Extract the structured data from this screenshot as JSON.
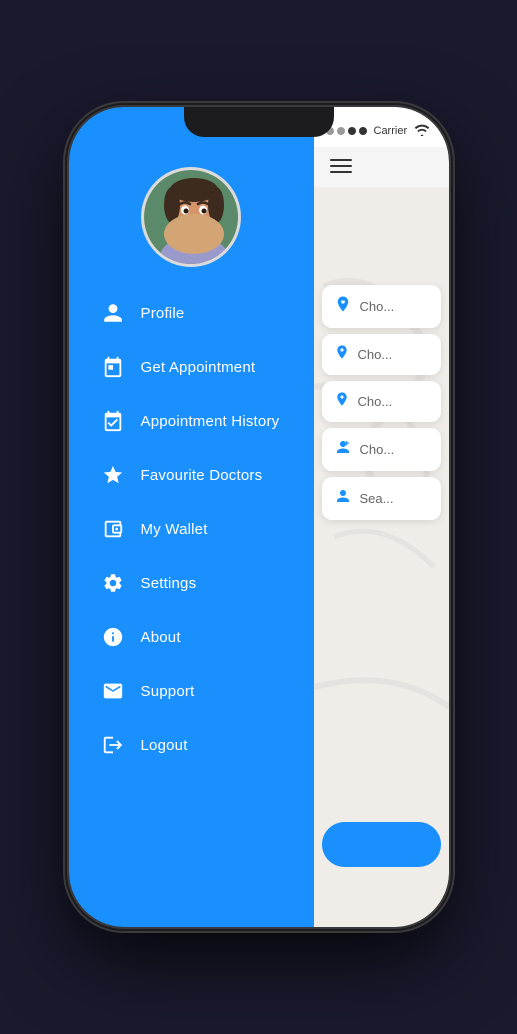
{
  "phone": {
    "status_bar": {
      "signal_dots": 4,
      "signal_filled": 2,
      "carrier": "Carrier",
      "wifi": "wifi"
    }
  },
  "sidebar": {
    "menu_items": [
      {
        "id": "profile",
        "label": "Profile",
        "icon": "person"
      },
      {
        "id": "get-appointment",
        "label": "Get Appointment",
        "icon": "calendar"
      },
      {
        "id": "appointment-history",
        "label": "Appointment History",
        "icon": "calendar-check"
      },
      {
        "id": "favourite-doctors",
        "label": "Favourite Doctors",
        "icon": "star"
      },
      {
        "id": "my-wallet",
        "label": "My Wallet",
        "icon": "wallet"
      },
      {
        "id": "settings",
        "label": "Settings",
        "icon": "gear"
      },
      {
        "id": "about",
        "label": "About",
        "icon": "info"
      },
      {
        "id": "support",
        "label": "Support",
        "icon": "email"
      },
      {
        "id": "logout",
        "label": "Logout",
        "icon": "logout"
      }
    ]
  },
  "right_panel": {
    "search_cards": [
      {
        "icon": "location-blue",
        "text": "Cho..."
      },
      {
        "icon": "pin",
        "text": "Cho..."
      },
      {
        "icon": "pin",
        "text": "Cho..."
      },
      {
        "icon": "person-blue",
        "text": "Cho..."
      },
      {
        "icon": "search-person",
        "text": "Sea..."
      }
    ]
  }
}
